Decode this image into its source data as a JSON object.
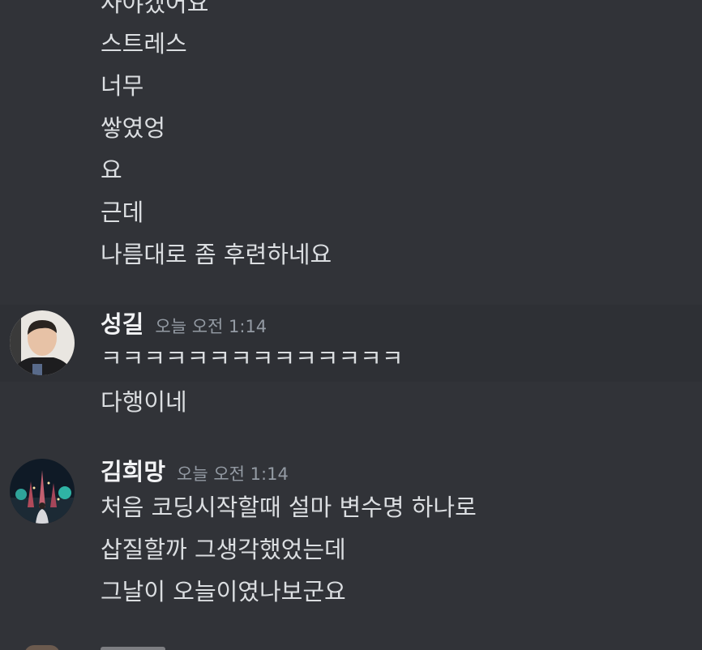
{
  "colors": {
    "background": "#313338",
    "hover_background": "#2e3035",
    "message_text": "#dbdee1",
    "username": "#f2f3f5",
    "timestamp": "#949ba4"
  },
  "previous_messages": [
    "사야겠어요",
    "스트레스",
    "너무",
    "쌓였엉",
    "요",
    "근데",
    "나름대로 좀 후련하네요"
  ],
  "groups": [
    {
      "username": "성길",
      "timestamp": "오늘 오전 1:14",
      "avatar_icon": "user-avatar-photo",
      "messages": [
        "ㅋㅋㅋㅋㅋㅋㅋㅋㅋㅋㅋㅋㅋㅋ",
        "다행이네"
      ]
    },
    {
      "username": "김희망",
      "timestamp": "오늘 오전 1:14",
      "avatar_icon": "user-avatar-photo",
      "messages": [
        "처음 코딩시작할때 설마 변수명 하나로",
        "삽질할까 그생각했었는데",
        "그날이 오늘이였나보군요"
      ]
    }
  ]
}
